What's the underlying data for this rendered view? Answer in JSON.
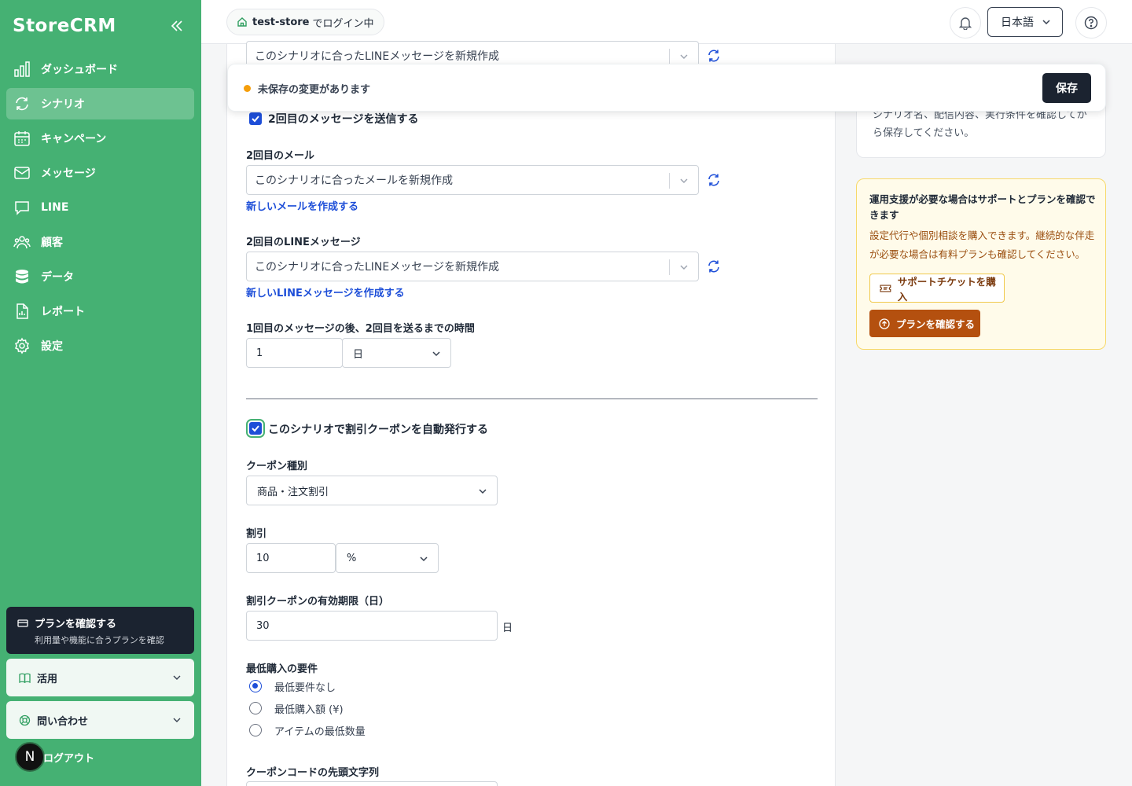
{
  "sidebar": {
    "brand": "StoreCRM",
    "items": [
      {
        "label": "ダッシュボード",
        "icon": "chart-bars-icon"
      },
      {
        "label": "シナリオ",
        "icon": "refresh-cycle-icon"
      },
      {
        "label": "キャンペーン",
        "icon": "calendar-icon"
      },
      {
        "label": "メッセージ",
        "icon": "mail-icon"
      },
      {
        "label": "LINE",
        "icon": "chat-icon"
      },
      {
        "label": "顧客",
        "icon": "users-icon"
      },
      {
        "label": "データ",
        "icon": "database-icon"
      },
      {
        "label": "レポート",
        "icon": "report-icon"
      },
      {
        "label": "設定",
        "icon": "gear-icon"
      }
    ],
    "active_item": "シナリオ",
    "plan_card": {
      "title": "プランを確認する",
      "subtitle": "利用量や機能に合うプランを確認"
    },
    "accordion_usage": "活用",
    "accordion_contact": "問い合わせ",
    "avatar_initial": "N",
    "logout": "ログアウト"
  },
  "topbar": {
    "store_name": "test-store",
    "store_suffix": "でログイン中",
    "language": "日本語"
  },
  "unsaved": {
    "message": "未保存の変更があります",
    "save_label": "保存"
  },
  "form": {
    "top_line_select": "このシナリオに合ったLINEメッセージを新規作成",
    "second_send_checkbox": "2回目のメッセージを送信する",
    "second_mail_label": "2回目のメール",
    "second_mail_select": "このシナリオに合ったメールを新規作成",
    "new_mail_link": "新しいメールを作成する",
    "second_line_label": "2回目のLINEメッセージ",
    "second_line_select": "このシナリオに合ったLINEメッセージを新規作成",
    "new_line_link": "新しいLINEメッセージを作成する",
    "interval_label": "1回目のメッセージの後、2回目を送るまでの時間",
    "interval_value": "1",
    "interval_unit": "日",
    "coupon_checkbox": "このシナリオで割引クーポンを自動発行する",
    "coupon_type_label": "クーポン種別",
    "coupon_type_value": "商品・注文割引",
    "discount_label": "割引",
    "discount_value": "10",
    "discount_unit": "%",
    "validity_label": "割引クーポンの有効期限（日）",
    "validity_value": "30",
    "validity_suffix": "日",
    "min_req_label": "最低購入の要件",
    "min_req_options": [
      "最低要件なし",
      "最低購入額 (¥)",
      "アイテムの最低数量"
    ],
    "min_req_selected": 0,
    "code_prefix_label": "クーポンコードの先頭文字列"
  },
  "right": {
    "info_text": "シナリオ名、配信内容、実行条件を確認してから保存してください。",
    "support_title": "運用支援が必要な場合はサポートとプランを確認できます",
    "support_text": "設定代行や個別相談を購入できます。継続的な伴走が必要な場合は有料プランも確認してください。",
    "ticket_button": "サポートチケットを購入",
    "plan_button": "プランを確認する"
  },
  "colors": {
    "sidebar_bg": "#45b173",
    "accent_blue": "#1d4ed8",
    "dark": "#1b2330",
    "warning": "#f59e0b",
    "support_btn": "#b4500f"
  }
}
